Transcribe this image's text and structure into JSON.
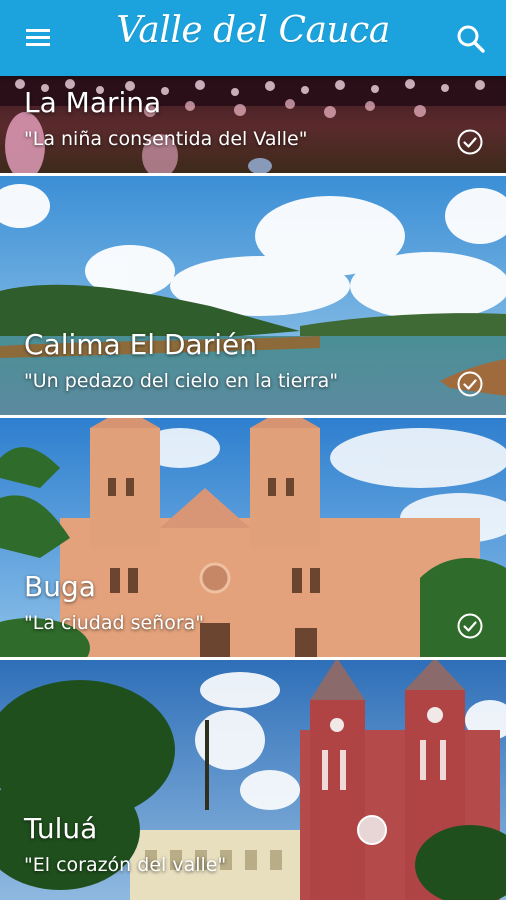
{
  "app": {
    "title": "Valle del Cauca",
    "menu_icon": "menu-icon",
    "search_icon": "search-icon",
    "brand_color": "#1ca3dd"
  },
  "destinations": [
    {
      "name": "La Marina",
      "tagline": "\"La niña consentida del Valle\"",
      "visited": true
    },
    {
      "name": "Calima El Darién",
      "tagline": "\"Un pedazo del cielo en la tierra\"",
      "visited": true
    },
    {
      "name": "Buga",
      "tagline": "\"La ciudad señora\"",
      "visited": true
    },
    {
      "name": "Tuluá",
      "tagline": "\"El corazón del valle\"",
      "visited": false
    }
  ]
}
